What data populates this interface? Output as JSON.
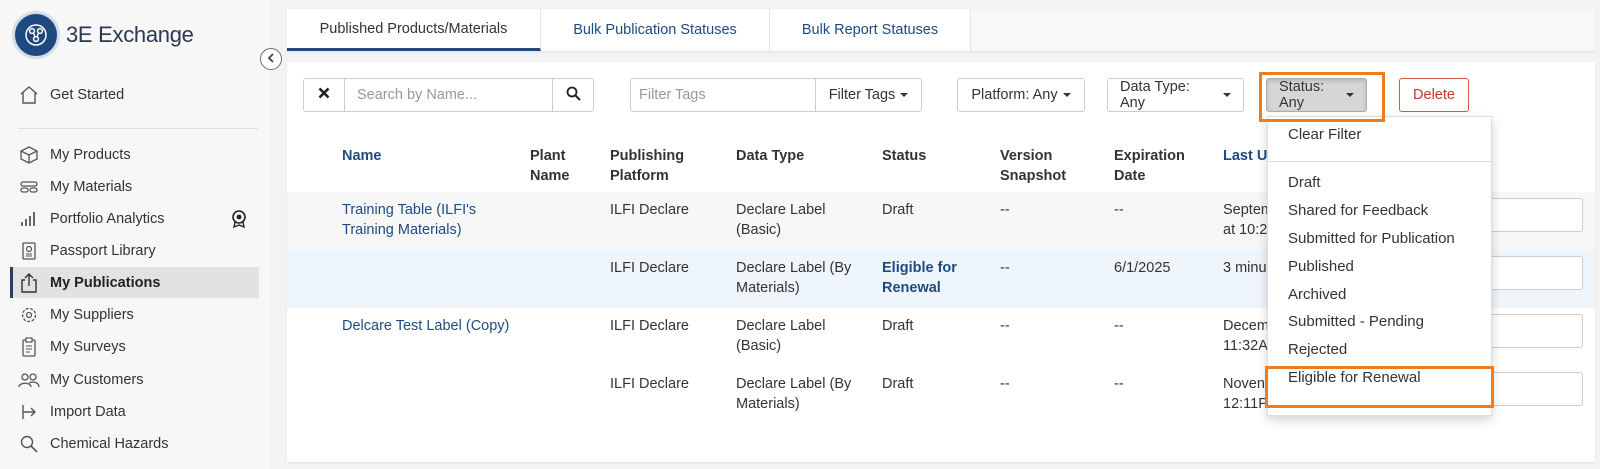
{
  "app": {
    "name": "3E Exchange"
  },
  "sidebar": {
    "items": [
      {
        "label": "Get Started",
        "icon": "home-icon"
      },
      {
        "label": "My Products",
        "icon": "box-icon"
      },
      {
        "label": "My Materials",
        "icon": "layers-icon"
      },
      {
        "label": "Portfolio Analytics",
        "icon": "bar-chart-icon",
        "badge": "award-badge-icon"
      },
      {
        "label": "Passport Library",
        "icon": "passport-icon"
      },
      {
        "label": "My Publications",
        "icon": "upload-icon",
        "active": true
      },
      {
        "label": "My Suppliers",
        "icon": "supplier-gear-icon"
      },
      {
        "label": "My Surveys",
        "icon": "clipboard-icon"
      },
      {
        "label": "My Customers",
        "icon": "users-icon"
      },
      {
        "label": "Import Data",
        "icon": "import-icon"
      },
      {
        "label": "Chemical Hazards",
        "icon": "search-icon"
      }
    ]
  },
  "tabs": [
    {
      "label": "Published Products/Materials",
      "active": true
    },
    {
      "label": "Bulk Publication Statuses"
    },
    {
      "label": "Bulk Report Statuses"
    }
  ],
  "toolbar": {
    "search_placeholder": "Search by Name...",
    "tags_placeholder": "Filter Tags",
    "filter_tags_label": "Filter Tags",
    "platform_label": "Platform: Any",
    "data_type_label": "Data Type: Any",
    "status_label": "Status: Any",
    "delete_label": "Delete"
  },
  "table": {
    "columns": [
      "Name",
      "Plant Name",
      "Publishing Platform",
      "Data Type",
      "Status",
      "Version Snapshot",
      "Expiration Date",
      "Last U"
    ],
    "rows": [
      {
        "name": "Training Table (ILFI's Training Materials)",
        "plant": "",
        "platform": "ILFI Declare",
        "data_type": "Declare Label (Basic)",
        "status": "Draft",
        "version": "--",
        "expiration": "--",
        "last": "Septem at 10:2"
      },
      {
        "name": "",
        "plant": "",
        "platform": "ILFI Declare",
        "data_type": "Declare Label (By Materials)",
        "status": "Eligible for Renewal",
        "version": "--",
        "expiration": "6/1/2025",
        "last": "3 minu"
      },
      {
        "name": "Delcare Test Label (Copy)",
        "plant": "",
        "platform": "ILFI Declare",
        "data_type": "Declare Label (Basic)",
        "status": "Draft",
        "version": "--",
        "expiration": "--",
        "last": "Decem 11:32A"
      },
      {
        "name": "",
        "plant": "",
        "platform": "ILFI Declare",
        "data_type": "Declare Label (By Materials)",
        "status": "Draft",
        "version": "--",
        "expiration": "--",
        "last": "Noven 12:11P"
      }
    ]
  },
  "status_dropdown": {
    "clear_label": "Clear Filter",
    "options": [
      "Draft",
      "Shared for Feedback",
      "Submitted for Publication",
      "Published",
      "Archived",
      "Submitted - Pending",
      "Rejected",
      "Eligible for Renewal"
    ]
  },
  "colors": {
    "accent": "#1f4a80",
    "highlight": "#f07c1e",
    "delete": "#c0392b"
  }
}
